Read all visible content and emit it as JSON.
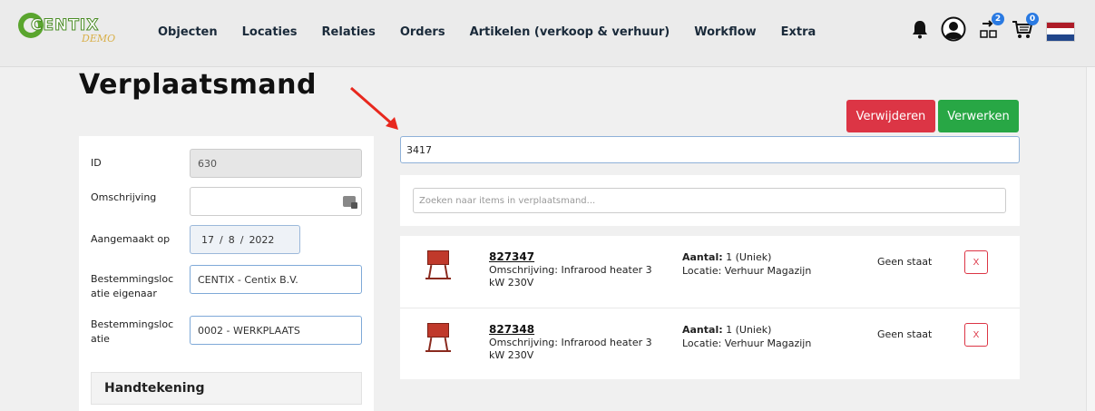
{
  "brand": {
    "name": "CENTIX",
    "sub": "DEMO"
  },
  "nav": {
    "items": [
      "Objecten",
      "Locaties",
      "Relaties",
      "Orders",
      "Artikelen (verkoop & verhuur)",
      "Workflow",
      "Extra"
    ],
    "icons": {
      "notifications": "bell-icon",
      "account": "user-circle-icon",
      "move_basket": "move-basket-icon",
      "cart": "cart-icon"
    },
    "move_badge": "2",
    "cart_badge": "0",
    "flag_colors": [
      "#ae1c28",
      "#ffffff",
      "#21468b"
    ]
  },
  "page": {
    "title": "Verplaatsmand"
  },
  "actions": {
    "delete_label": "Verwijderen",
    "process_label": "Verwerken"
  },
  "form": {
    "id_label": "ID",
    "id_value": "630",
    "description_label": "Omschrijving",
    "description_value": "",
    "created_label": "Aangemaakt op",
    "created_day": "17",
    "created_month": "8",
    "created_year": "2022",
    "owner_label": "Bestemmingsloc atie eigenaar",
    "owner_value": "CENTIX - Centix B.V.",
    "location_label": "Bestemmingsloc atie",
    "location_value": "0002 - WERKPLAATS",
    "signature_title": "Handtekening"
  },
  "scan": {
    "value": "3417"
  },
  "search": {
    "placeholder": "Zoeken naar items in verplaatsmand..."
  },
  "items": [
    {
      "code": "827347",
      "description": "Omschrijving: Infrarood heater 3 kW 230V",
      "qty_label": "Aantal:",
      "qty_value": "1 (Uniek)",
      "location": "Locatie: Verhuur Magazijn",
      "state": "Geen staat",
      "remove": "X"
    },
    {
      "code": "827348",
      "description": "Omschrijving: Infrarood heater 3 kW 230V",
      "qty_label": "Aantal:",
      "qty_value": "1 (Uniek)",
      "location": "Locatie: Verhuur Magazijn",
      "state": "Geen staat",
      "remove": "X"
    }
  ],
  "colors": {
    "danger": "#dc3545",
    "success": "#28a745",
    "brand_green": "#5aa52e",
    "badge_blue": "#2a7ae2"
  }
}
